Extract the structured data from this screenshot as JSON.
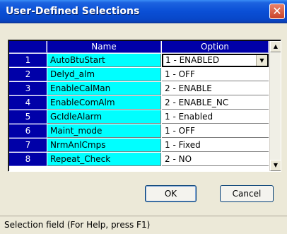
{
  "window": {
    "title": "User-Defined Selections",
    "close_glyph": "✕"
  },
  "grid": {
    "columns": {
      "name": "Name",
      "option": "Option"
    },
    "rows": [
      {
        "num": "1",
        "name": "AutoBtuStart",
        "option": "1 - ENABLED"
      },
      {
        "num": "2",
        "name": "Delyd_alm",
        "option": "1 - OFF"
      },
      {
        "num": "3",
        "name": "EnableCalMan",
        "option": "2 - ENABLE"
      },
      {
        "num": "4",
        "name": "EnableComAlm",
        "option": "2 - ENABLE_NC"
      },
      {
        "num": "5",
        "name": "GcIdleAlarm",
        "option": "1 - Enabled"
      },
      {
        "num": "6",
        "name": "Maint_mode",
        "option": "1 - OFF"
      },
      {
        "num": "7",
        "name": "NrmAnlCmps",
        "option": "1 - Fixed"
      },
      {
        "num": "8",
        "name": "Repeat_Check",
        "option": "2 - NO"
      }
    ],
    "dropdown_glyph": "▼",
    "scroll_up_glyph": "▲",
    "scroll_down_glyph": "▼"
  },
  "buttons": {
    "ok": "OK",
    "cancel": "Cancel"
  },
  "status_text": "Selection field (For Help, press F1)",
  "colors": {
    "row_header": "#0000a8",
    "name_cell": "#00ffff",
    "titlebar": "#0a4fd6"
  }
}
